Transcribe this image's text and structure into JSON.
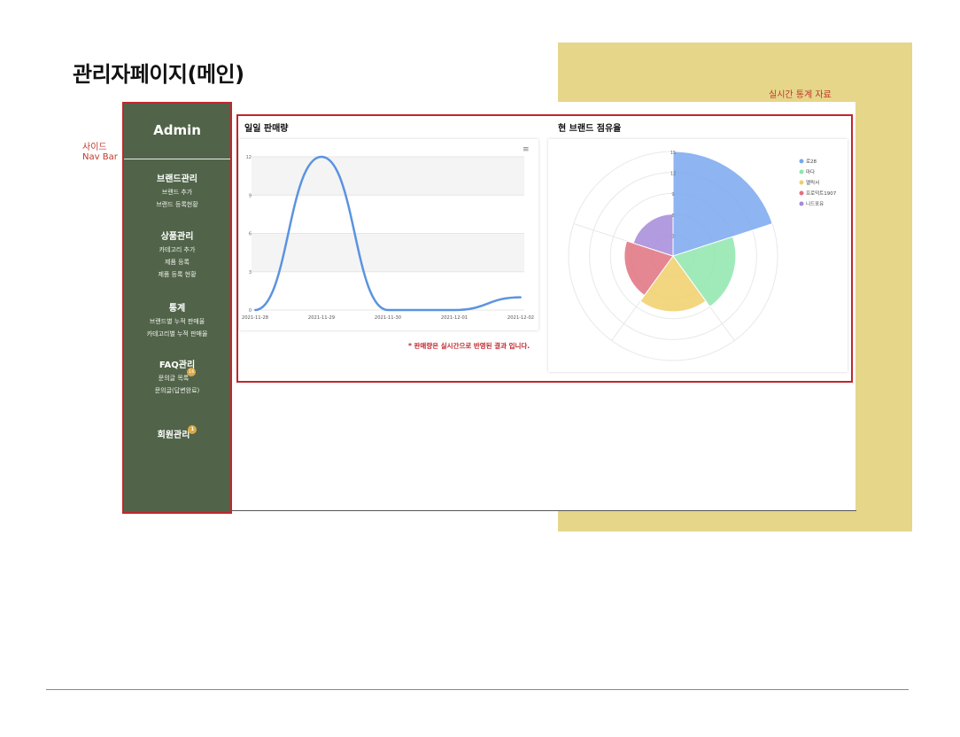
{
  "page": {
    "title": "관리자페이지(메인)"
  },
  "annotations": {
    "realtime_stats": "실시간 통계 자료",
    "side_line1": "사이드",
    "side_line2": "Nav Bar"
  },
  "sidebar": {
    "title": "Admin",
    "groups": [
      {
        "head": "브랜드관리",
        "items": [
          "브랜드 추가",
          "브랜드 등록현황"
        ]
      },
      {
        "head": "상품관리",
        "items": [
          "카테고리 추가",
          "제품 등록",
          "제품 등록 현황"
        ]
      },
      {
        "head": "통계",
        "items": [
          "브랜드별 누적 판매율",
          "카테고리별 누적 판매율"
        ]
      },
      {
        "head": "FAQ관리",
        "items": [
          "문의글 목록",
          "문의글(답변완료)"
        ],
        "badge": "16"
      },
      {
        "head": "회원관리",
        "items": [],
        "badge": "1"
      }
    ]
  },
  "main": {
    "daily_sales_title": "일일 판매량",
    "brand_share_title": "현 브랜드 점유율",
    "note": "* 판매량은 실시간으로 반영된 결과 입니다.",
    "menu_icon": "≡"
  },
  "colors": {
    "sidebar_bg": "#516449",
    "accent_red": "#c0272d",
    "highlight_yellow": "#e6d68a",
    "line_blue": "#5b93e0"
  },
  "chart_data": [
    {
      "type": "line",
      "title": "일일 판매량",
      "categories": [
        "2021-11-28",
        "2021-11-29",
        "2021-11-30",
        "2021-12-01",
        "2021-12-02"
      ],
      "series": [
        {
          "values": [
            0,
            12,
            0,
            0,
            1
          ]
        }
      ],
      "ylim": [
        0,
        12
      ],
      "yticks": [
        "0",
        "3",
        "6",
        "9",
        "12"
      ],
      "grid": true
    },
    {
      "type": "pie",
      "title": "현 브랜드 점유율",
      "labels": [
        "로28",
        "마다",
        "멜릭서",
        "프로덕트1907",
        "니드포유"
      ],
      "values": [
        15,
        9,
        8,
        7,
        6
      ],
      "colors": [
        "#7aa7f0",
        "#8fe6ad",
        "#f0cf6a",
        "#e0727f",
        "#a58ad8"
      ],
      "rticks": [
        "15",
        "12",
        "9",
        "6",
        "3"
      ],
      "legend": "right"
    }
  ]
}
